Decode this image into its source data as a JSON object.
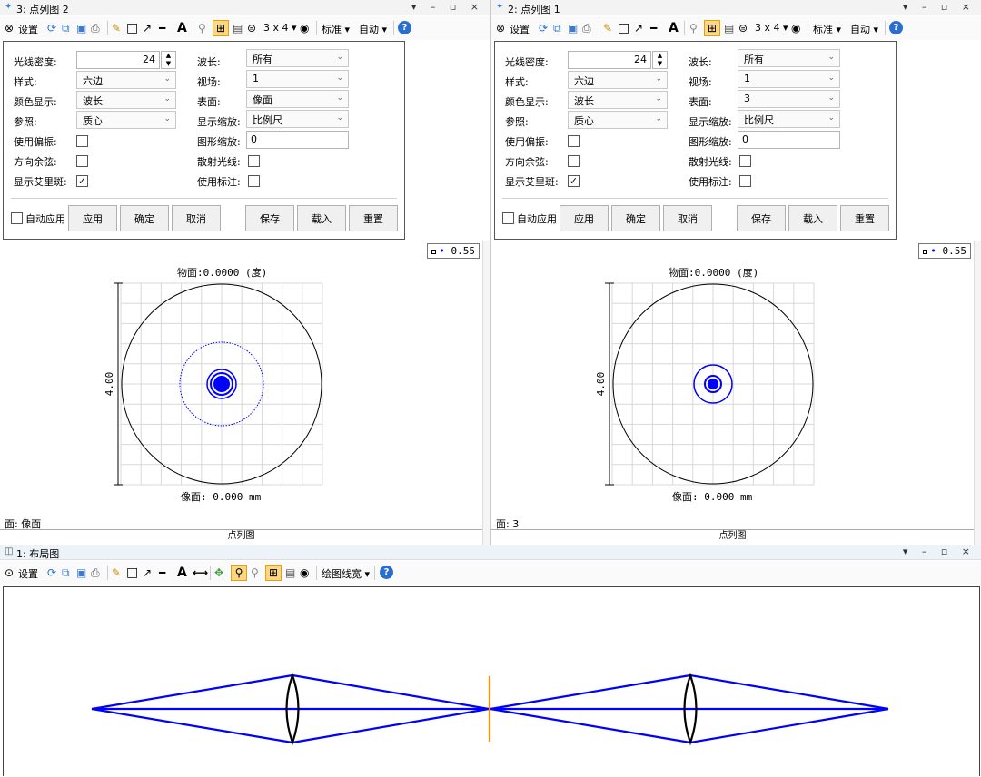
{
  "windows": {
    "controls": "▾ – ▫ ×"
  },
  "left": {
    "title": "3: 点列图 2",
    "surface_combo": "像面",
    "legend": "0.55",
    "surface_info": "面: 像面"
  },
  "right": {
    "title": "2: 点列图 1",
    "surface_combo": "3",
    "legend": "0.55",
    "surface_info": "面: 3"
  },
  "spot_toolbar": {
    "settings": "设置",
    "matrix": "3 x 4 ▾",
    "standard": "标准 ▾",
    "auto": "自动 ▾"
  },
  "settings_form": {
    "ray_density_label": "光线密度:",
    "ray_density_value": "24",
    "pattern_label": "样式:",
    "pattern_value": "六边",
    "color_label": "颜色显示:",
    "color_value": "波长",
    "reference_label": "参照:",
    "reference_value": "质心",
    "polarization_label": "使用偏振:",
    "direction_cosine_label": "方向余弦:",
    "airy_label": "显示艾里斑:",
    "wavelength_label": "波长:",
    "wavelength_value": "所有",
    "field_label": "视场:",
    "field_value": "1",
    "surface_label": "表面:",
    "display_scale_label": "显示缩放:",
    "display_scale_value": "比例尺",
    "plot_scale_label": "图形缩放:",
    "plot_scale_value": "0",
    "scatter_label": "散射光线:",
    "use_symbols_label": "使用标注:",
    "auto_apply": "自动应用",
    "apply": "应用",
    "ok": "确定",
    "cancel": "取消",
    "save": "保存",
    "load": "载入",
    "reset": "重置"
  },
  "spot": {
    "object_caption": "物面:0.0000 (度)",
    "image_caption": "像面: 0.000 mm",
    "scale_label": "4.00",
    "tab": "点列图"
  },
  "layout": {
    "title": "1: 布局图",
    "settings": "设置",
    "line_width": "绘图线宽 ▾"
  },
  "colors": {
    "ray": "#0000ff",
    "lens": "#000000",
    "stop": "#ff8c00",
    "airy": "#000000"
  }
}
